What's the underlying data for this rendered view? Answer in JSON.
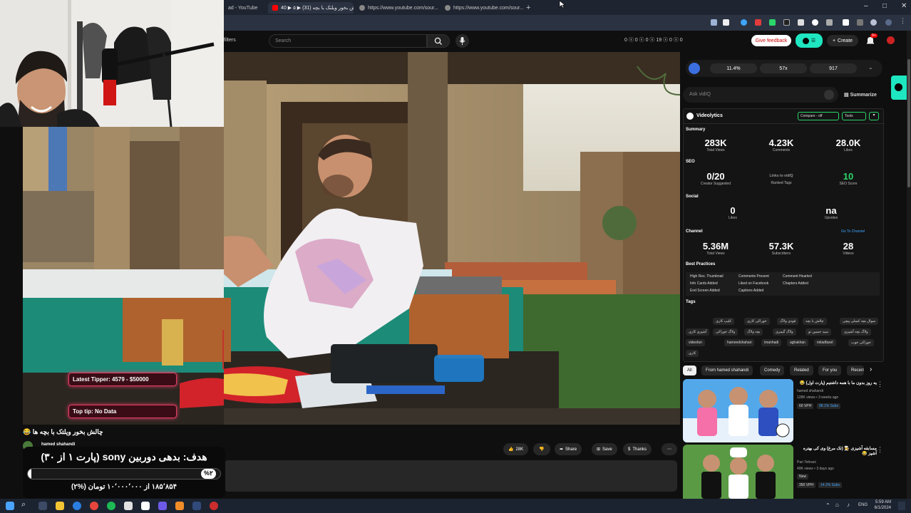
{
  "browser": {
    "tabs": [
      {
        "label": "ad - YouTube",
        "icon": "youtube-icon"
      },
      {
        "label": "چالش بخور ویلتک با بچه (31) ▶ ۵ ▶ 40",
        "icon": "youtube-icon"
      },
      {
        "label": "https://www.youtube.com/sour...",
        "icon": "globe-icon"
      },
      {
        "label": "https://www.youtube.com/sour...",
        "icon": "globe-icon"
      }
    ],
    "new_tab": "+"
  },
  "youtube": {
    "search_placeholder": "Search",
    "filters_label": "filters",
    "header_stats": "0 ⓢ 0 ⓢ 0 ⓢ 19 ⓢ 0 ⓢ 0",
    "give_feedback": "Give feedback",
    "create_label": "Create",
    "notif_count": "9+"
  },
  "vidiq": {
    "top_stats": [
      "11.4%",
      "57x",
      "917"
    ],
    "ask_placeholder": "Ask vidIQ",
    "summarize": "Summarize"
  },
  "videolytics": {
    "title": "Videolytics",
    "compare_btn": "Compare - off",
    "tools_btn": "Tools",
    "summary_label": "Summary",
    "summary": [
      {
        "value": "283K",
        "label": "Total Views"
      },
      {
        "value": "4.23K",
        "label": "Comments"
      },
      {
        "value": "28.0K",
        "label": "Likes"
      }
    ],
    "seo_label": "SEO",
    "seo": [
      {
        "value": "0/20",
        "label": "Creator Suggested"
      },
      {
        "value": "",
        "label": "Ranked Tags"
      },
      {
        "value": "10",
        "label": "SEO Score"
      }
    ],
    "social_label": "Social",
    "social": [
      {
        "value": "0",
        "label": "Likes"
      },
      {
        "value": "na",
        "label": "Upvotes"
      }
    ],
    "channel_label": "Channel",
    "channel_link": "Go To Channel",
    "channel": [
      {
        "value": "5.36M",
        "label": "Total Views"
      },
      {
        "value": "57.3K",
        "label": "Subscribers"
      },
      {
        "value": "28",
        "label": "Videos"
      }
    ],
    "best_practices_label": "Best Practices",
    "best_practices": [
      "High Res. Thumbnail",
      "Comments Present",
      "Comment Hearted",
      "Info Cards Added",
      "Liked on Facebook",
      "Chapters Added",
      "End Screen Added",
      "Captions Added"
    ],
    "tags_label": "Tags",
    "tags": [
      "سوال بچه کسلی پیچی",
      "چالش با بچه",
      "فودی ولاگ",
      "خوراکی کاری",
      "کلیپ کاری",
      "ولاگ بچه آشپزی",
      "سید حسین تو",
      "ولاگ گیمری",
      "بچه ولاگ",
      "ولاگ خوراکی",
      "آشپزی کاری",
      "خوراکی خوب",
      "hameedshahari",
      "imanhadi",
      "aghakhan",
      "miladfazel",
      "videofun",
      "کاری"
    ]
  },
  "chips": [
    "All",
    "From hamed shahandi",
    "Comedy",
    "Related",
    "For you",
    "Recently uploaded"
  ],
  "recommendations": [
    {
      "title": "یه روز بدون ما با همه داشتیم (پارت اول) 😂",
      "channel": "hamed shahandi",
      "meta": "128K views • 3 weeks ago",
      "badges": [
        "60 VPH",
        "98.1% Subs"
      ]
    },
    {
      "title": "مسابقه آشپزی 🧑‍🍳 (تک مرغ) وی کی بهتره آشپز 😂",
      "channel": "Pari Tehrani",
      "meta": "49K views • 3 days ago",
      "badges": [
        "New",
        "350 VPH",
        "14.2% Subs"
      ]
    }
  ],
  "video": {
    "title": "چالش بخور ویلتک با بچه ها 😂",
    "channel": "hamed shahandi",
    "likes": "28K",
    "share": "Share",
    "save": "Save",
    "thanks": "Thanks",
    "more": "⋯"
  },
  "stream_overlay": {
    "latest_tipper": "Latest Tipper: 4579 - $50000",
    "top_tip": "Top tip: No Data",
    "goal_title": "هدف: بدهی دوربین sony (پارت ۱ از ۳۰)",
    "goal_percent_badge": "%۲",
    "goal_progress": 0.02,
    "goal_amount": "۱۸۵٬۸۵۴ از ۱۰٬۰۰۰٬۰۰۰ تومان (%۲)"
  },
  "taskbar": {
    "lang": "ENG",
    "time": "5:59 AM",
    "date": "6/1/2024"
  },
  "colors": {
    "accent_red": "#ff0000",
    "vidiq_teal": "#1ee6c0",
    "tip_border": "#e23c64",
    "link_blue": "#3ea6ff",
    "seo_green": "#2bd66b"
  }
}
